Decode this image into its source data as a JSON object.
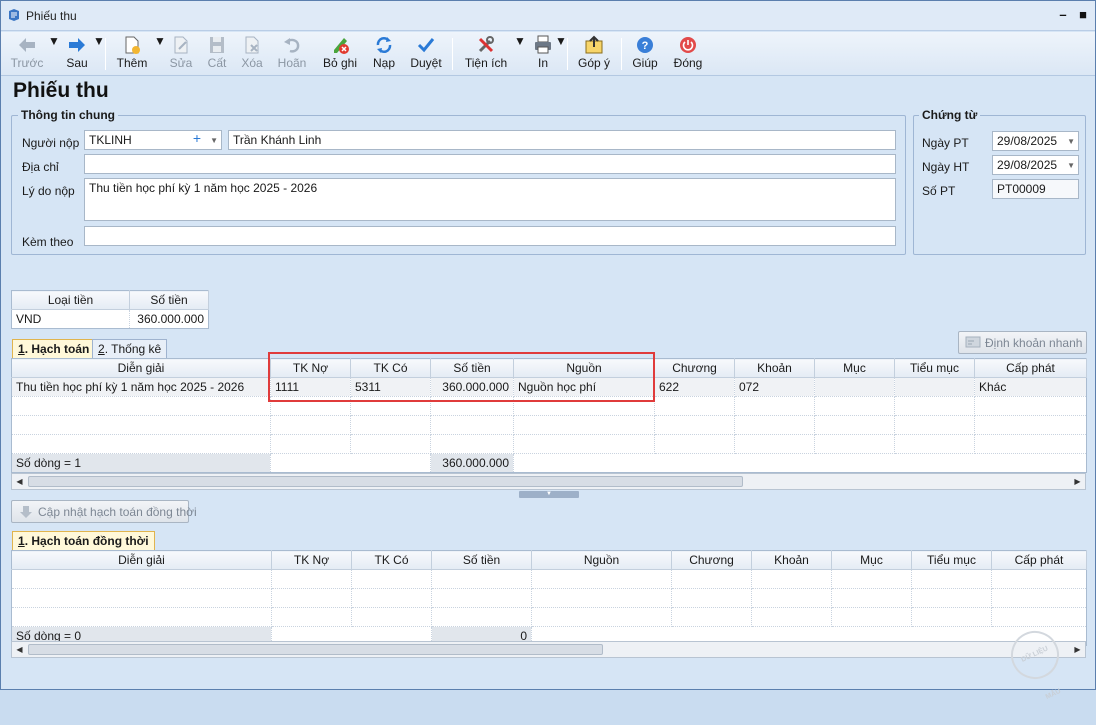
{
  "window": {
    "title": "Phiếu thu"
  },
  "toolbar": {
    "prev": "Trước",
    "next": "Sau",
    "add": "Thêm",
    "edit": "Sửa",
    "save": "Cất",
    "delete": "Xóa",
    "undo": "Hoãn",
    "unpost": "Bỏ ghi",
    "reload": "Nạp",
    "approve": "Duyệt",
    "utilities": "Tiện ích",
    "print": "In",
    "feedback": "Góp ý",
    "help": "Giúp",
    "close": "Đóng"
  },
  "page": {
    "title": "Phiếu thu"
  },
  "general": {
    "group_title": "Thông tin chung",
    "payer_label": "Người nộp",
    "payer_code": "TKLINH",
    "payer_name": "Trần Khánh Linh",
    "address_label": "Địa chỉ",
    "address_value": "",
    "reason_label": "Lý do nộp",
    "reason_value": "Thu tiền học phí kỳ 1 năm học 2025 - 2026",
    "attach_label": "Kèm theo",
    "attach_value": ""
  },
  "voucher": {
    "group_title": "Chứng từ",
    "date_pt_label": "Ngày PT",
    "date_pt": "29/08/2025",
    "date_ht_label": "Ngày HT",
    "date_ht": "29/08/2025",
    "no_label": "Số PT",
    "no_value": "PT00009"
  },
  "currency": {
    "headers": [
      "Loại tiền",
      "Số tiền"
    ],
    "row": [
      "VND",
      "360.000.000"
    ]
  },
  "quick_entry_label": "Định khoản nhanh",
  "tabs": {
    "accounting": {
      "num": "1",
      "label": ". Hạch toán"
    },
    "stats": {
      "num": "2",
      "label": ". Thống kê"
    },
    "simultaneous": {
      "num": "1",
      "label": ". Hạch toán đồng thời"
    }
  },
  "grid1": {
    "headers": [
      "Diễn giải",
      "TK Nợ",
      "TK Có",
      "Số tiền",
      "Nguồn",
      "Chương",
      "Khoản",
      "Mục",
      "Tiểu mục",
      "Cấp phát"
    ],
    "row": [
      "Thu tiền học phí kỳ 1 năm học 2025 - 2026",
      "1111",
      "5311",
      "360.000.000",
      "Nguồn học phí",
      "622",
      "072",
      "",
      "",
      "Khác"
    ],
    "footer_count": "Số dòng = 1",
    "footer_total": "360.000.000"
  },
  "update_button": "Cập nhật hạch toán đồng thời",
  "grid2": {
    "headers": [
      "Diễn giải",
      "TK Nợ",
      "TK Có",
      "Số tiền",
      "Nguồn",
      "Chương",
      "Khoản",
      "Mục",
      "Tiểu mục",
      "Cấp phát"
    ],
    "footer_count": "Số dòng = 0",
    "footer_total": "0"
  }
}
